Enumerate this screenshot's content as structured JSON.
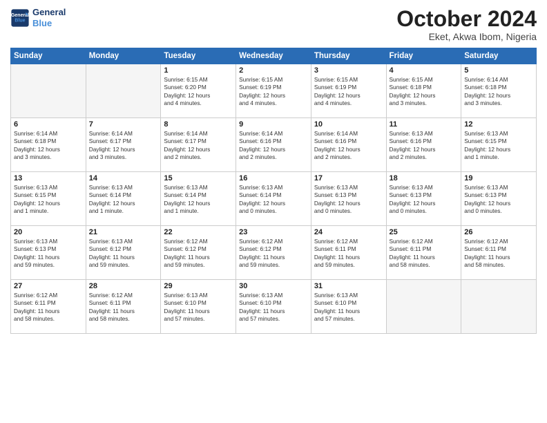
{
  "header": {
    "logo_line1": "General",
    "logo_line2": "Blue",
    "month": "October 2024",
    "location": "Eket, Akwa Ibom, Nigeria"
  },
  "weekdays": [
    "Sunday",
    "Monday",
    "Tuesday",
    "Wednesday",
    "Thursday",
    "Friday",
    "Saturday"
  ],
  "weeks": [
    [
      {
        "day": "",
        "text": ""
      },
      {
        "day": "",
        "text": ""
      },
      {
        "day": "1",
        "text": "Sunrise: 6:15 AM\nSunset: 6:20 PM\nDaylight: 12 hours\nand 4 minutes."
      },
      {
        "day": "2",
        "text": "Sunrise: 6:15 AM\nSunset: 6:19 PM\nDaylight: 12 hours\nand 4 minutes."
      },
      {
        "day": "3",
        "text": "Sunrise: 6:15 AM\nSunset: 6:19 PM\nDaylight: 12 hours\nand 4 minutes."
      },
      {
        "day": "4",
        "text": "Sunrise: 6:15 AM\nSunset: 6:18 PM\nDaylight: 12 hours\nand 3 minutes."
      },
      {
        "day": "5",
        "text": "Sunrise: 6:14 AM\nSunset: 6:18 PM\nDaylight: 12 hours\nand 3 minutes."
      }
    ],
    [
      {
        "day": "6",
        "text": "Sunrise: 6:14 AM\nSunset: 6:18 PM\nDaylight: 12 hours\nand 3 minutes."
      },
      {
        "day": "7",
        "text": "Sunrise: 6:14 AM\nSunset: 6:17 PM\nDaylight: 12 hours\nand 3 minutes."
      },
      {
        "day": "8",
        "text": "Sunrise: 6:14 AM\nSunset: 6:17 PM\nDaylight: 12 hours\nand 2 minutes."
      },
      {
        "day": "9",
        "text": "Sunrise: 6:14 AM\nSunset: 6:16 PM\nDaylight: 12 hours\nand 2 minutes."
      },
      {
        "day": "10",
        "text": "Sunrise: 6:14 AM\nSunset: 6:16 PM\nDaylight: 12 hours\nand 2 minutes."
      },
      {
        "day": "11",
        "text": "Sunrise: 6:13 AM\nSunset: 6:16 PM\nDaylight: 12 hours\nand 2 minutes."
      },
      {
        "day": "12",
        "text": "Sunrise: 6:13 AM\nSunset: 6:15 PM\nDaylight: 12 hours\nand 1 minute."
      }
    ],
    [
      {
        "day": "13",
        "text": "Sunrise: 6:13 AM\nSunset: 6:15 PM\nDaylight: 12 hours\nand 1 minute."
      },
      {
        "day": "14",
        "text": "Sunrise: 6:13 AM\nSunset: 6:14 PM\nDaylight: 12 hours\nand 1 minute."
      },
      {
        "day": "15",
        "text": "Sunrise: 6:13 AM\nSunset: 6:14 PM\nDaylight: 12 hours\nand 1 minute."
      },
      {
        "day": "16",
        "text": "Sunrise: 6:13 AM\nSunset: 6:14 PM\nDaylight: 12 hours\nand 0 minutes."
      },
      {
        "day": "17",
        "text": "Sunrise: 6:13 AM\nSunset: 6:13 PM\nDaylight: 12 hours\nand 0 minutes."
      },
      {
        "day": "18",
        "text": "Sunrise: 6:13 AM\nSunset: 6:13 PM\nDaylight: 12 hours\nand 0 minutes."
      },
      {
        "day": "19",
        "text": "Sunrise: 6:13 AM\nSunset: 6:13 PM\nDaylight: 12 hours\nand 0 minutes."
      }
    ],
    [
      {
        "day": "20",
        "text": "Sunrise: 6:13 AM\nSunset: 6:13 PM\nDaylight: 11 hours\nand 59 minutes."
      },
      {
        "day": "21",
        "text": "Sunrise: 6:13 AM\nSunset: 6:12 PM\nDaylight: 11 hours\nand 59 minutes."
      },
      {
        "day": "22",
        "text": "Sunrise: 6:12 AM\nSunset: 6:12 PM\nDaylight: 11 hours\nand 59 minutes."
      },
      {
        "day": "23",
        "text": "Sunrise: 6:12 AM\nSunset: 6:12 PM\nDaylight: 11 hours\nand 59 minutes."
      },
      {
        "day": "24",
        "text": "Sunrise: 6:12 AM\nSunset: 6:11 PM\nDaylight: 11 hours\nand 59 minutes."
      },
      {
        "day": "25",
        "text": "Sunrise: 6:12 AM\nSunset: 6:11 PM\nDaylight: 11 hours\nand 58 minutes."
      },
      {
        "day": "26",
        "text": "Sunrise: 6:12 AM\nSunset: 6:11 PM\nDaylight: 11 hours\nand 58 minutes."
      }
    ],
    [
      {
        "day": "27",
        "text": "Sunrise: 6:12 AM\nSunset: 6:11 PM\nDaylight: 11 hours\nand 58 minutes."
      },
      {
        "day": "28",
        "text": "Sunrise: 6:12 AM\nSunset: 6:11 PM\nDaylight: 11 hours\nand 58 minutes."
      },
      {
        "day": "29",
        "text": "Sunrise: 6:13 AM\nSunset: 6:10 PM\nDaylight: 11 hours\nand 57 minutes."
      },
      {
        "day": "30",
        "text": "Sunrise: 6:13 AM\nSunset: 6:10 PM\nDaylight: 11 hours\nand 57 minutes."
      },
      {
        "day": "31",
        "text": "Sunrise: 6:13 AM\nSunset: 6:10 PM\nDaylight: 11 hours\nand 57 minutes."
      },
      {
        "day": "",
        "text": ""
      },
      {
        "day": "",
        "text": ""
      }
    ]
  ]
}
